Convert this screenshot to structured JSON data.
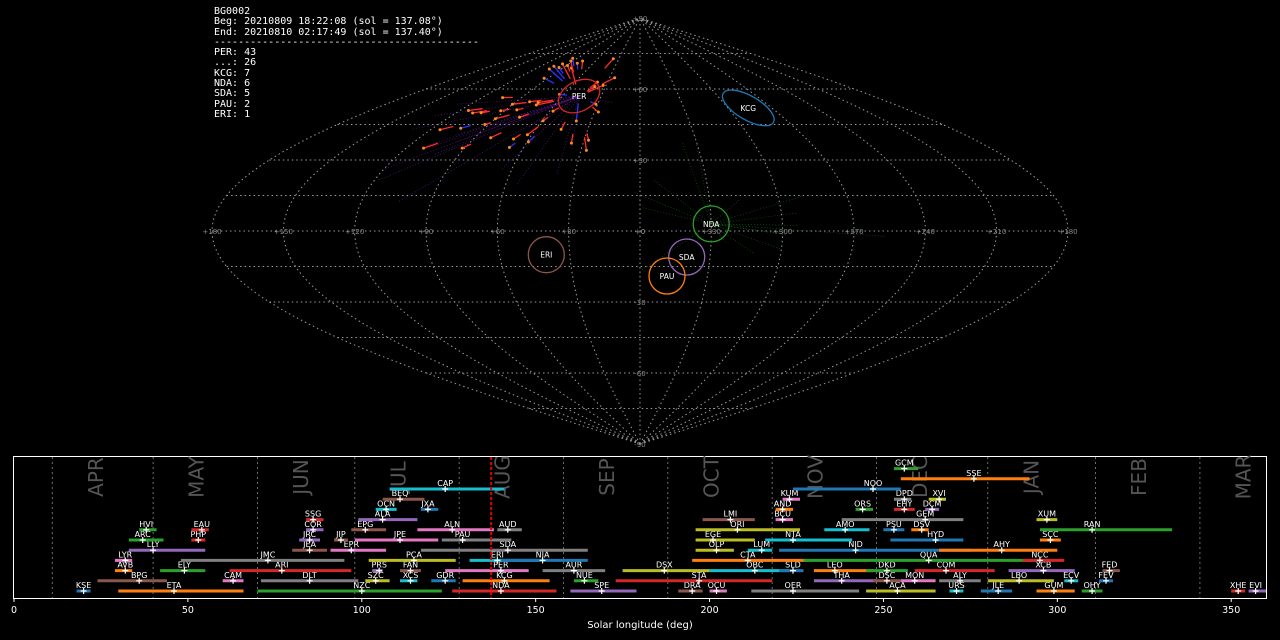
{
  "header": {
    "id": "BG0002",
    "beg": "Beg: 20210809 18:22:08 (sol = 137.08°)",
    "end": "End: 20210810 02:17:49 (sol = 137.40°)",
    "sep": "--------------------------------------------",
    "counts": [
      "PER: 43",
      "...: 26",
      "KCG: 7",
      "NDA: 6",
      "SDA: 5",
      "PAU: 2",
      "ERI: 1"
    ]
  },
  "colors": {
    "background": "#000000",
    "grid": "#9a9a9a",
    "meteor_red": "#ff2a2a",
    "meteor_blue": "#3030ff",
    "meteor_point": "#ff8c1a",
    "per": "#d62728",
    "kcg": "#1f77b4",
    "nda": "#2ca02c",
    "sda": "#9467bd",
    "pau": "#ff7f0e",
    "eri": "#8c564b",
    "current_sol": "#e00000"
  },
  "chart_data": [
    {
      "type": "scatter",
      "projection": "sinusoidal",
      "lon_tick_labels": [
        "+180",
        "+150",
        "+120",
        "+90",
        "+60",
        "+30",
        "+0",
        "+330",
        "+300",
        "+270",
        "+240",
        "+210",
        "+180"
      ],
      "lat_tick_labels": [
        "+90",
        "+60",
        "+30",
        "+0",
        "-30",
        "-60",
        "-90"
      ],
      "radiants": [
        {
          "name": "PER",
          "lon": 47,
          "lat": 57,
          "color_key": "per"
        },
        {
          "name": "KCG",
          "lon": 286,
          "lat": 52,
          "color_key": "kcg"
        },
        {
          "name": "NDA",
          "lon": 330,
          "lat": 3,
          "color_key": "nda"
        },
        {
          "name": "SDA",
          "lon": 340,
          "lat": -11,
          "color_key": "sda"
        },
        {
          "name": "PAU",
          "lon": 348,
          "lat": -19,
          "color_key": "pau"
        },
        {
          "name": "ERI",
          "lon": 40,
          "lat": -10,
          "color_key": "eri"
        }
      ]
    },
    {
      "type": "timeline",
      "xlabel": "Solar longitude (deg)",
      "xlim": [
        0,
        360
      ],
      "x_ticks": [
        0,
        50,
        100,
        150,
        200,
        250,
        300,
        350
      ],
      "current_sol": 137.2,
      "months": [
        {
          "label": "APR",
          "sol": 11
        },
        {
          "label": "MAY",
          "sol": 40
        },
        {
          "label": "JUN",
          "sol": 70
        },
        {
          "label": "JUL",
          "sol": 98
        },
        {
          "label": "AUG",
          "sol": 128
        },
        {
          "label": "SEP",
          "sol": 158
        },
        {
          "label": "OCT",
          "sol": 188
        },
        {
          "label": "NOV",
          "sol": 218
        },
        {
          "label": "DEC",
          "sol": 248
        },
        {
          "label": "JAN",
          "sol": 280
        },
        {
          "label": "FEB",
          "sol": 311
        },
        {
          "label": "MAR",
          "sol": 341
        }
      ],
      "showers": [
        {
          "code": "KSE",
          "start": 18,
          "end": 22,
          "peak": 20,
          "row": 0,
          "color": "#1f77b4"
        },
        {
          "code": "ETA",
          "start": 30,
          "end": 66,
          "peak": 46,
          "row": 0,
          "color": "#ff7f0e"
        },
        {
          "code": "NZC",
          "start": 70,
          "end": 123,
          "peak": 100,
          "row": 0,
          "color": "#2ca02c"
        },
        {
          "code": "NDA",
          "start": 126,
          "end": 156,
          "peak": 140,
          "row": 0,
          "color": "#d62728"
        },
        {
          "code": "SPE",
          "start": 160,
          "end": 179,
          "peak": 169,
          "row": 0,
          "color": "#9467bd"
        },
        {
          "code": "DRA",
          "start": 191,
          "end": 198,
          "peak": 195,
          "row": 0,
          "color": "#8c564b"
        },
        {
          "code": "OCU",
          "start": 200,
          "end": 205,
          "peak": 202,
          "row": 0,
          "color": "#e377c2"
        },
        {
          "code": "OER",
          "start": 212,
          "end": 243,
          "peak": 224,
          "row": 0,
          "color": "#7f7f7f"
        },
        {
          "code": "ACA",
          "start": 245,
          "end": 265,
          "peak": 254,
          "row": 0,
          "color": "#bcbd22"
        },
        {
          "code": "URS",
          "start": 269,
          "end": 273,
          "peak": 271,
          "row": 0,
          "color": "#17becf"
        },
        {
          "code": "JLE",
          "start": 278,
          "end": 287,
          "peak": 283,
          "row": 0,
          "color": "#1f77b4"
        },
        {
          "code": "GUM",
          "start": 294,
          "end": 305,
          "peak": 299,
          "row": 0,
          "color": "#ff7f0e"
        },
        {
          "code": "OHY",
          "start": 307,
          "end": 313,
          "peak": 310,
          "row": 0,
          "color": "#2ca02c"
        },
        {
          "code": "XHE",
          "start": 350,
          "end": 354,
          "peak": 352,
          "row": 0,
          "color": "#d62728"
        },
        {
          "code": "EVI",
          "start": 355,
          "end": 360,
          "peak": 357,
          "row": 0,
          "color": "#9467bd"
        },
        {
          "code": "BPG",
          "start": 24,
          "end": 44,
          "peak": 36,
          "row": 1,
          "color": "#8c564b"
        },
        {
          "code": "CAM",
          "start": 60,
          "end": 66,
          "peak": 63,
          "row": 1,
          "color": "#e377c2"
        },
        {
          "code": "DLT",
          "start": 71,
          "end": 99,
          "peak": 85,
          "row": 1,
          "color": "#7f7f7f"
        },
        {
          "code": "SZC",
          "start": 101,
          "end": 108,
          "peak": 104,
          "row": 1,
          "color": "#bcbd22"
        },
        {
          "code": "XCS",
          "start": 111,
          "end": 116,
          "peak": 114,
          "row": 1,
          "color": "#17becf"
        },
        {
          "code": "GDR",
          "start": 120,
          "end": 127,
          "peak": 124,
          "row": 1,
          "color": "#1f77b4"
        },
        {
          "code": "KCG",
          "start": 129,
          "end": 154,
          "peak": 141,
          "row": 1,
          "color": "#ff7f0e"
        },
        {
          "code": "NUE",
          "start": 161,
          "end": 168,
          "peak": 164,
          "row": 1,
          "color": "#2ca02c"
        },
        {
          "code": "STA",
          "start": 173,
          "end": 218,
          "peak": 197,
          "row": 1,
          "color": "#d62728"
        },
        {
          "code": "THA",
          "start": 230,
          "end": 248,
          "peak": 238,
          "row": 1,
          "color": "#9467bd"
        },
        {
          "code": "DSC",
          "start": 247,
          "end": 255,
          "peak": 251,
          "row": 1,
          "color": "#8c564b"
        },
        {
          "code": "MON",
          "start": 255,
          "end": 265,
          "peak": 259,
          "row": 1,
          "color": "#e377c2"
        },
        {
          "code": "ALY",
          "start": 266,
          "end": 278,
          "peak": 272,
          "row": 1,
          "color": "#7f7f7f"
        },
        {
          "code": "LBO",
          "start": 280,
          "end": 299,
          "peak": 289,
          "row": 1,
          "color": "#bcbd22"
        },
        {
          "code": "ECV",
          "start": 302,
          "end": 306,
          "peak": 304,
          "row": 1,
          "color": "#17becf"
        },
        {
          "code": "FEV",
          "start": 312,
          "end": 316,
          "peak": 314,
          "row": 1,
          "color": "#1f77b4"
        },
        {
          "code": "AVB",
          "start": 29,
          "end": 34,
          "peak": 32,
          "row": 2,
          "color": "#ff7f0e"
        },
        {
          "code": "ELY",
          "start": 42,
          "end": 55,
          "peak": 49,
          "row": 2,
          "color": "#2ca02c"
        },
        {
          "code": "ARI",
          "start": 62,
          "end": 97,
          "peak": 77,
          "row": 2,
          "color": "#d62728"
        },
        {
          "code": "PRS",
          "start": 103,
          "end": 106,
          "peak": 105,
          "row": 2,
          "color": "#9467bd"
        },
        {
          "code": "FAN",
          "start": 111,
          "end": 117,
          "peak": 114,
          "row": 2,
          "color": "#8c564b"
        },
        {
          "code": "PER",
          "start": 124,
          "end": 148,
          "peak": 140,
          "row": 2,
          "color": "#e377c2"
        },
        {
          "code": "AUR",
          "start": 152,
          "end": 170,
          "peak": 161,
          "row": 2,
          "color": "#7f7f7f"
        },
        {
          "code": "DSX",
          "start": 175,
          "end": 200,
          "peak": 187,
          "row": 2,
          "color": "#bcbd22"
        },
        {
          "code": "OBC",
          "start": 200,
          "end": 223,
          "peak": 213,
          "row": 2,
          "color": "#17becf"
        },
        {
          "code": "SLD",
          "start": 220,
          "end": 227,
          "peak": 224,
          "row": 2,
          "color": "#1f77b4"
        },
        {
          "code": "LEO",
          "start": 230,
          "end": 247,
          "peak": 236,
          "row": 2,
          "color": "#ff7f0e"
        },
        {
          "code": "DKD",
          "start": 245,
          "end": 257,
          "peak": 251,
          "row": 2,
          "color": "#2ca02c"
        },
        {
          "code": "COM",
          "start": 259,
          "end": 282,
          "peak": 268,
          "row": 2,
          "color": "#d62728"
        },
        {
          "code": "XCB",
          "start": 286,
          "end": 305,
          "peak": 296,
          "row": 2,
          "color": "#9467bd"
        },
        {
          "code": "FED",
          "start": 313,
          "end": 318,
          "peak": 315,
          "row": 2,
          "color": "#8c564b"
        },
        {
          "code": "LYR",
          "start": 29,
          "end": 34,
          "peak": 32,
          "row": 3,
          "color": "#e377c2"
        },
        {
          "code": "JMC",
          "start": 48,
          "end": 95,
          "peak": 73,
          "row": 3,
          "color": "#7f7f7f"
        },
        {
          "code": "PCA",
          "start": 102,
          "end": 127,
          "peak": 115,
          "row": 3,
          "color": "#bcbd22"
        },
        {
          "code": "ERI",
          "start": 131,
          "end": 151,
          "peak": 139,
          "row": 3,
          "color": "#17becf"
        },
        {
          "code": "NIA",
          "start": 140,
          "end": 165,
          "peak": 152,
          "row": 3,
          "color": "#1f77b4"
        },
        {
          "code": "CTA",
          "start": 195,
          "end": 228,
          "peak": 211,
          "row": 3,
          "color": "#ff7f0e"
        },
        {
          "code": "QUA",
          "start": 227,
          "end": 296,
          "peak": 263,
          "row": 3,
          "color": "#2ca02c"
        },
        {
          "code": "NCC",
          "start": 290,
          "end": 302,
          "peak": 295,
          "row": 3,
          "color": "#d62728"
        },
        {
          "code": "LLY",
          "start": 33,
          "end": 55,
          "peak": 40,
          "row": 4,
          "color": "#9467bd"
        },
        {
          "code": "JEA",
          "start": 80,
          "end": 90,
          "peak": 85,
          "row": 4,
          "color": "#8c564b"
        },
        {
          "code": "EPR",
          "start": 91,
          "end": 107,
          "peak": 97,
          "row": 4,
          "color": "#e377c2"
        },
        {
          "code": "SDA",
          "start": 117,
          "end": 165,
          "peak": 142,
          "row": 4,
          "color": "#7f7f7f"
        },
        {
          "code": "OLP",
          "start": 196,
          "end": 207,
          "peak": 202,
          "row": 4,
          "color": "#bcbd22"
        },
        {
          "code": "LUM",
          "start": 211,
          "end": 218,
          "peak": 215,
          "row": 4,
          "color": "#17becf"
        },
        {
          "code": "NID",
          "start": 220,
          "end": 275,
          "peak": 242,
          "row": 4,
          "color": "#1f77b4"
        },
        {
          "code": "AHY",
          "start": 266,
          "end": 300,
          "peak": 284,
          "row": 4,
          "color": "#ff7f0e"
        },
        {
          "code": "ARC",
          "start": 33,
          "end": 43,
          "peak": 37,
          "row": 5,
          "color": "#2ca02c"
        },
        {
          "code": "PHP",
          "start": 51,
          "end": 55,
          "peak": 53,
          "row": 5,
          "color": "#d62728"
        },
        {
          "code": "JRC",
          "start": 82,
          "end": 88,
          "peak": 85,
          "row": 5,
          "color": "#9467bd"
        },
        {
          "code": "JIP",
          "start": 92,
          "end": 96,
          "peak": 94,
          "row": 5,
          "color": "#8c564b"
        },
        {
          "code": "JPE",
          "start": 98,
          "end": 122,
          "peak": 111,
          "row": 5,
          "color": "#e377c2"
        },
        {
          "code": "PAU",
          "start": 123,
          "end": 143,
          "peak": 129,
          "row": 5,
          "color": "#7f7f7f"
        },
        {
          "code": "EGE",
          "start": 196,
          "end": 213,
          "peak": 201,
          "row": 5,
          "color": "#bcbd22"
        },
        {
          "code": "NTA",
          "start": 216,
          "end": 241,
          "peak": 224,
          "row": 5,
          "color": "#17becf"
        },
        {
          "code": "HYD",
          "start": 252,
          "end": 273,
          "peak": 265,
          "row": 5,
          "color": "#1f77b4"
        },
        {
          "code": "SCC",
          "start": 295,
          "end": 301,
          "peak": 298,
          "row": 5,
          "color": "#ff7f0e"
        },
        {
          "code": "HVI",
          "start": 36,
          "end": 41,
          "peak": 38,
          "row": 6,
          "color": "#2ca02c"
        },
        {
          "code": "EAU",
          "start": 51,
          "end": 56,
          "peak": 54,
          "row": 6,
          "color": "#d62728"
        },
        {
          "code": "COR",
          "start": 84,
          "end": 89,
          "peak": 86,
          "row": 6,
          "color": "#9467bd"
        },
        {
          "code": "EPG",
          "start": 97,
          "end": 107,
          "peak": 101,
          "row": 6,
          "color": "#8c564b"
        },
        {
          "code": "ALN",
          "start": 116,
          "end": 138,
          "peak": 126,
          "row": 6,
          "color": "#e377c2"
        },
        {
          "code": "AUD",
          "start": 139,
          "end": 146,
          "peak": 142,
          "row": 6,
          "color": "#7f7f7f"
        },
        {
          "code": "ORI",
          "start": 196,
          "end": 226,
          "peak": 208,
          "row": 6,
          "color": "#bcbd22"
        },
        {
          "code": "AMO",
          "start": 233,
          "end": 246,
          "peak": 239,
          "row": 6,
          "color": "#17becf"
        },
        {
          "code": "PSU",
          "start": 250,
          "end": 256,
          "peak": 253,
          "row": 6,
          "color": "#1f77b4"
        },
        {
          "code": "DSV",
          "start": 258,
          "end": 263,
          "peak": 261,
          "row": 6,
          "color": "#ff7f0e"
        },
        {
          "code": "RAN",
          "start": 295,
          "end": 333,
          "peak": 310,
          "row": 6,
          "color": "#2ca02c"
        },
        {
          "code": "SSG",
          "start": 84,
          "end": 89,
          "peak": 86,
          "row": 7,
          "color": "#d62728"
        },
        {
          "code": "ALA",
          "start": 99,
          "end": 116,
          "peak": 106,
          "row": 7,
          "color": "#9467bd"
        },
        {
          "code": "LMI",
          "start": 198,
          "end": 213,
          "peak": 206,
          "row": 7,
          "color": "#8c564b"
        },
        {
          "code": "BCU",
          "start": 219,
          "end": 224,
          "peak": 221,
          "row": 7,
          "color": "#e377c2"
        },
        {
          "code": "GEM",
          "start": 238,
          "end": 273,
          "peak": 262,
          "row": 7,
          "color": "#7f7f7f"
        },
        {
          "code": "XUM",
          "start": 294,
          "end": 300,
          "peak": 297,
          "row": 7,
          "color": "#bcbd22"
        },
        {
          "code": "OCN",
          "start": 104,
          "end": 110,
          "peak": 107,
          "row": 8,
          "color": "#17becf"
        },
        {
          "code": "JXA",
          "start": 117,
          "end": 122,
          "peak": 119,
          "row": 8,
          "color": "#1f77b4"
        },
        {
          "code": "AND",
          "start": 219,
          "end": 224,
          "peak": 221,
          "row": 8,
          "color": "#ff7f0e"
        },
        {
          "code": "ORS",
          "start": 242,
          "end": 247,
          "peak": 244,
          "row": 8,
          "color": "#2ca02c"
        },
        {
          "code": "EHY",
          "start": 253,
          "end": 259,
          "peak": 256,
          "row": 8,
          "color": "#d62728"
        },
        {
          "code": "DCM",
          "start": 262,
          "end": 266,
          "peak": 264,
          "row": 8,
          "color": "#9467bd"
        },
        {
          "code": "BEQ",
          "start": 106,
          "end": 118,
          "peak": 111,
          "row": 9,
          "color": "#8c564b"
        },
        {
          "code": "KUM",
          "start": 221,
          "end": 226,
          "peak": 223,
          "row": 9,
          "color": "#e377c2"
        },
        {
          "code": "DPD",
          "start": 253,
          "end": 258,
          "peak": 256,
          "row": 9,
          "color": "#7f7f7f"
        },
        {
          "code": "XVI",
          "start": 263,
          "end": 268,
          "peak": 266,
          "row": 9,
          "color": "#bcbd22"
        },
        {
          "code": "CAP",
          "start": 108,
          "end": 141,
          "peak": 124,
          "row": 10,
          "color": "#17becf"
        },
        {
          "code": "NOO",
          "start": 224,
          "end": 255,
          "peak": 247,
          "row": 10,
          "color": "#1f77b4"
        },
        {
          "code": "SSE",
          "start": 255,
          "end": 292,
          "peak": 276,
          "row": 11,
          "color": "#ff7f0e"
        },
        {
          "code": "GCM",
          "start": 253,
          "end": 260,
          "peak": 256,
          "row": 12,
          "color": "#2ca02c"
        }
      ]
    }
  ]
}
